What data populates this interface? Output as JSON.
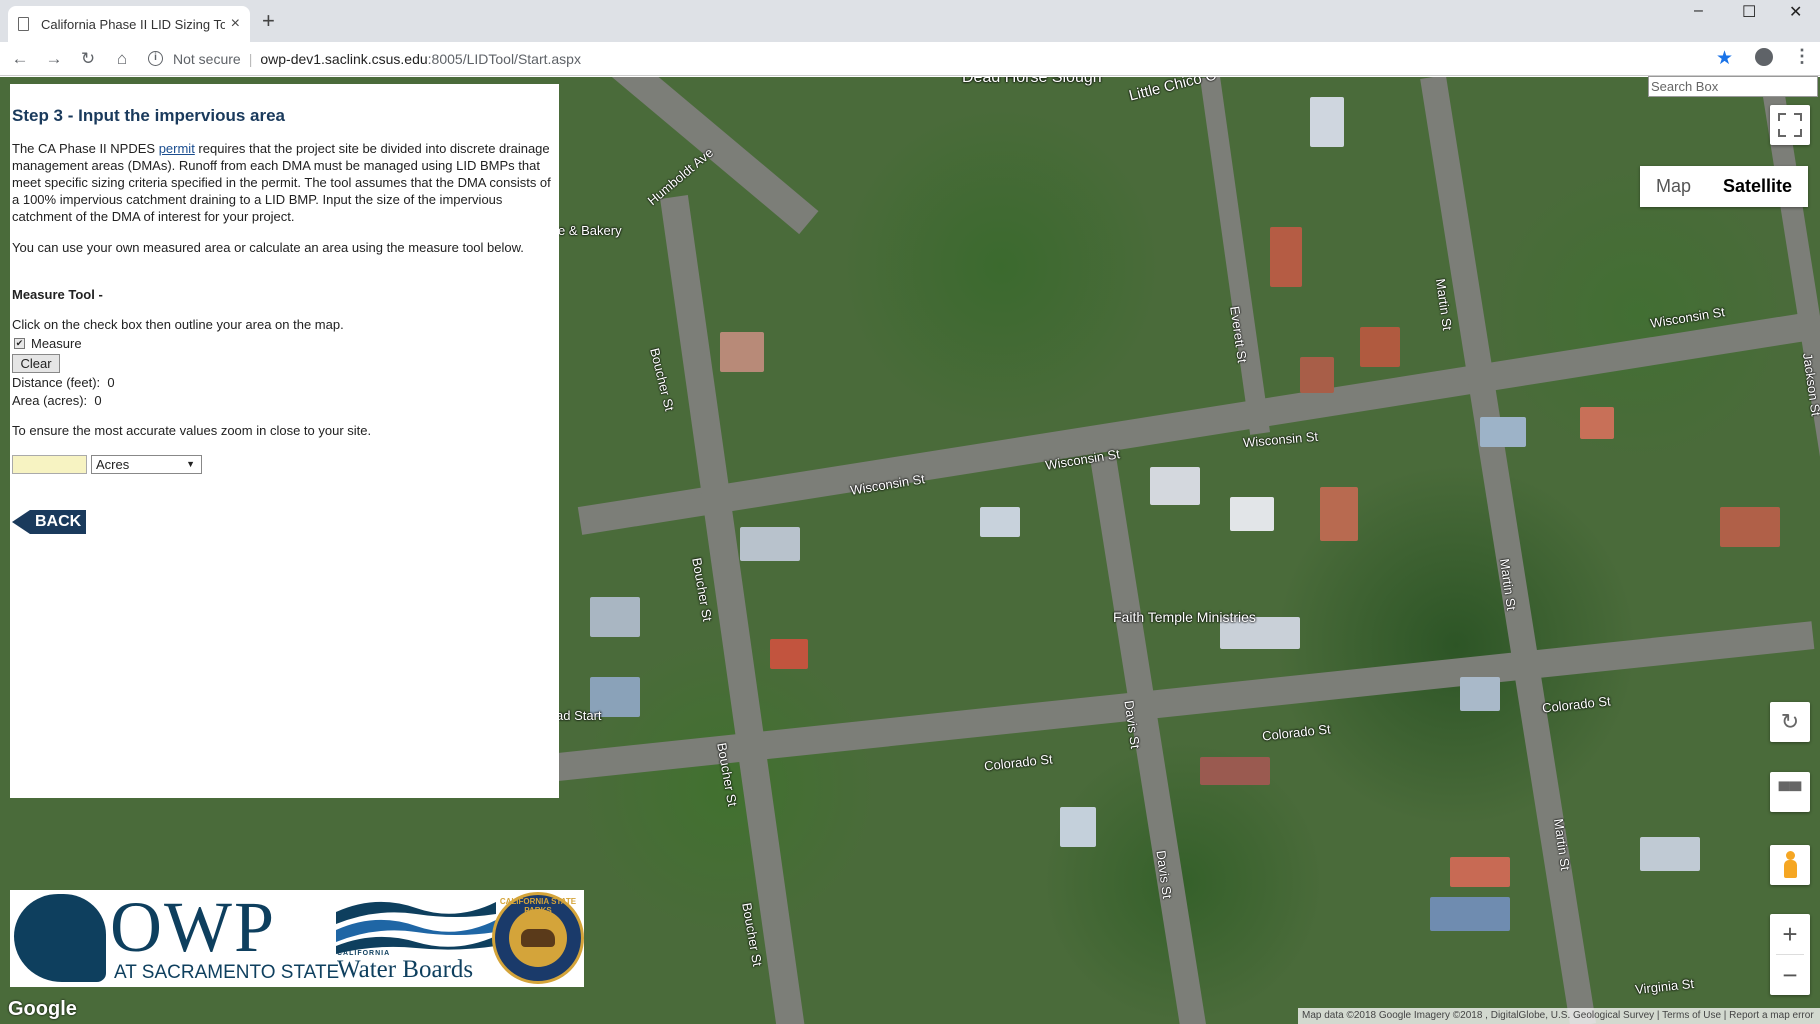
{
  "browser": {
    "tab_title": "California Phase II LID Sizing Too",
    "tab_close": "×",
    "new_tab": "+",
    "not_secure": "Not secure",
    "url_host": "owp-dev1.saclink.csus.edu",
    "url_rest": ":8005/LIDTool/Start.aspx",
    "window_minimize": "–",
    "window_maximize": "☐",
    "window_close": "✕"
  },
  "panel": {
    "heading": "Step 3 - Input the impervious area",
    "p1_before": "The CA Phase II NPDES ",
    "p1_link": "permit",
    "p1_after": " requires that the project site be divided into discrete drainage management areas (DMAs). Runoff from each DMA must be managed using LID BMPs that meet specific sizing criteria specified in the permit. The tool assumes that the DMA consists of a 100% impervious catchment draining to a LID BMP. Input the size of the impervious catchment of the DMA of interest for your project.",
    "p2": "You can use your own measured area or calculate an area using the measure tool below.",
    "measure_tool_label": "Measure Tool -",
    "measure_instructions": "Click on the check box then outline your area on the map.",
    "measure_checkbox_label": "Measure",
    "measure_checked": true,
    "clear_button": "Clear",
    "distance_label": "Distance (feet):",
    "distance_value": "0",
    "area_label": "Area (acres):",
    "area_value": "0",
    "zoom_note": "To ensure the most accurate values zoom in close to your site.",
    "area_input_value": "",
    "units_selected": "Acres",
    "back_button": "BACK"
  },
  "map": {
    "search_placeholder": "Search Box",
    "map_type_map": "Map",
    "map_type_satellite": "Satellite",
    "selected_map_type": "Satellite",
    "google_logo": "Google",
    "attribution": "Map data ©2018 Google Imagery ©2018 , DigitalGlobe, U.S. Geological Survey  |  Terms of Use  |  Report a map error",
    "labels": {
      "dead_horse_slough": "Dead Horse Slough",
      "little_chico": "Little Chico C",
      "humboldt_ave": "Humboldt Ave",
      "bakery": "e & Bakery",
      "boucher_st": "Boucher St",
      "wisconsin_st": "Wisconsin St",
      "everett_st": "Everett St",
      "martin_st": "Martin St",
      "jackson_st": "Jackson St",
      "faith_temple": "Faith Temple Ministries",
      "davis_st": "Davis St",
      "colorado_st": "Colorado St",
      "virginia_st": "Virginia St",
      "head_start": "ad Start"
    }
  },
  "logos": {
    "owp": "OWP",
    "owp_sub": "AT SACRAMENTO STATE",
    "wb_california": "CALIFORNIA",
    "wb_name": "Water Boards",
    "seal_text": "CALIFORNIA STATE PARKS"
  }
}
